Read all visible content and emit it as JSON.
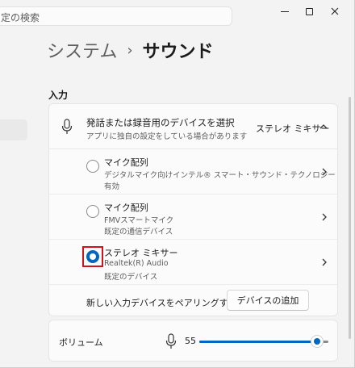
{
  "titlebar": {
    "search_placeholder": "定の検索"
  },
  "breadcrumb": {
    "parent": "システム",
    "separator": "›",
    "current": "サウンド"
  },
  "input_section": {
    "label": "入力",
    "header": {
      "title": "発話または録音用のデバイスを選択",
      "subtitle": "アプリに独自の設定をしている場合があります",
      "selected_value": "ステレオ ミキサー"
    },
    "devices": [
      {
        "name": "マイク配列",
        "lines": [
          "デジタルマイク向けインテル® スマート・サウンド・テクノロジー",
          "有効"
        ],
        "selected": false
      },
      {
        "name": "マイク配列",
        "lines": [
          "FMVスマートマイク",
          "既定の通信デバイス"
        ],
        "selected": false
      },
      {
        "name": "ステレオ ミキサー",
        "lines": [
          "Realtek(R) Audio",
          "既定のデバイス"
        ],
        "selected": true
      }
    ],
    "pair_text": "新しい入力デバイスをペアリングする",
    "add_button": "デバイスの追加"
  },
  "volume": {
    "label": "ボリューム",
    "value": "55",
    "level": 55
  },
  "colors": {
    "accent": "#0067c0",
    "focus": "#d0141b"
  }
}
